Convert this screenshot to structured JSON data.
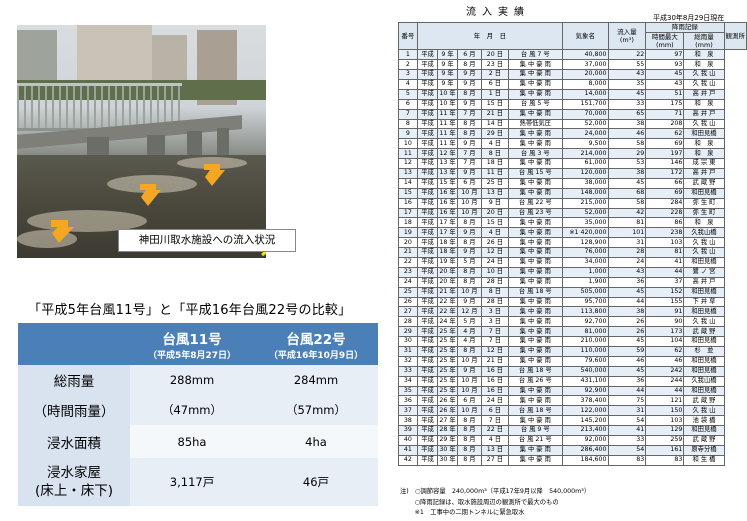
{
  "photo": {
    "caption": "神田川取水施設への流入状況"
  },
  "comparison": {
    "title": "「平成5年台風11号」と「平成16年台風22号の比較」",
    "col1_name": "台風11号",
    "col1_date": "（平成5年8月27日）",
    "col2_name": "台風22号",
    "col2_date": "（平成16年10月9日）",
    "rows": [
      {
        "label": "総雨量",
        "v1": "288mm",
        "v2": "284mm"
      },
      {
        "label": "（時間雨量）",
        "v1": "（47mm）",
        "v2": "（57mm）"
      },
      {
        "label": "浸水面積",
        "v1": "85ha",
        "v2": "4ha"
      },
      {
        "label": "浸水家屋",
        "label2": "(床上・床下)",
        "v1": "3,117戸",
        "v2": "46戸"
      }
    ]
  },
  "inflow": {
    "title": "流入実績",
    "date": "平成30年8月29日現在",
    "headers": {
      "no": "番号",
      "ymd": "年　月　日",
      "type": "気象名",
      "volume": "流入量",
      "volume_unit": "(m³)",
      "rain_group": "降雨記録",
      "max_rain": "時間最大",
      "max_unit": "(mm)",
      "total_rain": "総雨量",
      "total_unit": "(mm)",
      "station": "観測所"
    },
    "rows": [
      [
        "1",
        "平成",
        "9",
        "6",
        "20",
        "台 風 7 号",
        "40,800",
        "22",
        "97",
        "和　泉"
      ],
      [
        "2",
        "平成",
        "9",
        "8",
        "23",
        "集 中 豪 雨",
        "37,000",
        "55",
        "93",
        "和　泉"
      ],
      [
        "3",
        "平成",
        "9",
        "9",
        "2",
        "集 中 豪 雨",
        "20,000",
        "43",
        "45",
        "久 我 山"
      ],
      [
        "4",
        "平成",
        "9",
        "9",
        "6",
        "集 中 豪 雨",
        "8,000",
        "35",
        "43",
        "久 我 山"
      ],
      [
        "5",
        "平成",
        "10",
        "8",
        "1",
        "集 中 豪 雨",
        "14,000",
        "45",
        "51",
        "高 井 戸"
      ],
      [
        "6",
        "平成",
        "10",
        "9",
        "15",
        "台 風 5 号",
        "151,700",
        "33",
        "175",
        "和　泉"
      ],
      [
        "7",
        "平成",
        "11",
        "7",
        "21",
        "集 中 豪 雨",
        "70,000",
        "65",
        "71",
        "高 井 戸"
      ],
      [
        "8",
        "平成",
        "11",
        "8",
        "14",
        "熱帯低気圧",
        "52,000",
        "38",
        "208",
        "久 我 山"
      ],
      [
        "9",
        "平成",
        "11",
        "8",
        "29",
        "集 中 豪 雨",
        "24,000",
        "46",
        "62",
        "和田見橋"
      ],
      [
        "10",
        "平成",
        "11",
        "9",
        "4",
        "集 中 豪 雨",
        "9,500",
        "58",
        "69",
        "和　泉"
      ],
      [
        "11",
        "平成",
        "12",
        "7",
        "8",
        "台 風 3 号",
        "214,000",
        "29",
        "197",
        "和　泉"
      ],
      [
        "12",
        "平成",
        "13",
        "7",
        "18",
        "集 中 豪 雨",
        "61,000",
        "53",
        "146",
        "成 宗 東"
      ],
      [
        "13",
        "平成",
        "13",
        "9",
        "11",
        "台 風 15 号",
        "120,000",
        "38",
        "172",
        "高 井 戸"
      ],
      [
        "14",
        "平成",
        "15",
        "6",
        "25",
        "集 中 豪 雨",
        "38,000",
        "45",
        "66",
        "武 蔵 野"
      ],
      [
        "15",
        "平成",
        "16",
        "10",
        "13",
        "集 中 豪 雨",
        "148,000",
        "68",
        "69",
        "和田見橋"
      ],
      [
        "16",
        "平成",
        "16",
        "10",
        "9",
        "台 風 22 号",
        "215,000",
        "58",
        "284",
        "弥 生 町"
      ],
      [
        "17",
        "平成",
        "16",
        "10",
        "20",
        "台 風 23 号",
        "52,000",
        "42",
        "228",
        "弥 生 町"
      ],
      [
        "18",
        "平成",
        "17",
        "8",
        "15",
        "集 中 豪 雨",
        "35,000",
        "81",
        "86",
        "和　泉"
      ],
      [
        "19",
        "平成",
        "17",
        "9",
        "4",
        "集 中 豪 雨",
        "※1 420,000",
        "101",
        "238",
        "久我山橋"
      ],
      [
        "20",
        "平成",
        "18",
        "8",
        "26",
        "集 中 豪 雨",
        "128,900",
        "31",
        "103",
        "久 我 山"
      ],
      [
        "21",
        "平成",
        "18",
        "9",
        "12",
        "集 中 豪 雨",
        "76,000",
        "28",
        "81",
        "久 我 山"
      ],
      [
        "22",
        "平成",
        "19",
        "5",
        "24",
        "集 中 豪 雨",
        "34,000",
        "24",
        "41",
        "和田見橋"
      ],
      [
        "23",
        "平成",
        "20",
        "8",
        "10",
        "集 中 豪 雨",
        "1,000",
        "43",
        "44",
        "鷺 ノ 宮"
      ],
      [
        "24",
        "平成",
        "20",
        "8",
        "28",
        "集 中 豪 雨",
        "1,900",
        "36",
        "37",
        "高 井 戸"
      ],
      [
        "25",
        "平成",
        "21",
        "10",
        "8",
        "台 風 18 号",
        "505,000",
        "45",
        "152",
        "和田見橋"
      ],
      [
        "26",
        "平成",
        "22",
        "9",
        "28",
        "集 中 豪 雨",
        "95,700",
        "44",
        "155",
        "下 井 草"
      ],
      [
        "27",
        "平成",
        "22",
        "12",
        "3",
        "集 中 豪 雨",
        "113,800",
        "38",
        "91",
        "和田見橋"
      ],
      [
        "28",
        "平成",
        "24",
        "5",
        "3",
        "集 中 豪 雨",
        "92,700",
        "26",
        "90",
        "久 我 山"
      ],
      [
        "29",
        "平成",
        "25",
        "4",
        "7",
        "集 中 豪 雨",
        "81,000",
        "26",
        "173",
        "武 蔵 野"
      ],
      [
        "30",
        "平成",
        "25",
        "4",
        "7",
        "集 中 豪 雨",
        "210,000",
        "45",
        "104",
        "和田見橋"
      ],
      [
        "31",
        "平成",
        "25",
        "8",
        "12",
        "集 中 豪 雨",
        "110,000",
        "59",
        "62",
        "杉　並"
      ],
      [
        "32",
        "平成",
        "25",
        "10",
        "21",
        "集 中 豪 雨",
        "79,600",
        "46",
        "46",
        "和田見橋"
      ],
      [
        "33",
        "平成",
        "25",
        "9",
        "16",
        "台 風 18 号",
        "540,000",
        "45",
        "242",
        "和田見橋"
      ],
      [
        "34",
        "平成",
        "25",
        "10",
        "16",
        "台 風 26 号",
        "431,100",
        "36",
        "244",
        "久我山橋"
      ],
      [
        "35",
        "平成",
        "25",
        "10",
        "16",
        "集 中 豪 雨",
        "92,900",
        "44",
        "44",
        "和田見橋"
      ],
      [
        "36",
        "平成",
        "26",
        "6",
        "24",
        "集 中 豪 雨",
        "378,400",
        "75",
        "121",
        "武 蔵 野"
      ],
      [
        "37",
        "平成",
        "26",
        "10",
        "6",
        "台 風 18 号",
        "122,000",
        "31",
        "150",
        "久 我 山"
      ],
      [
        "38",
        "平成",
        "27",
        "8",
        "7",
        "集 中 豪 雨",
        "145,200",
        "54",
        "103",
        "池 袋 橋"
      ],
      [
        "39",
        "平成",
        "28",
        "8",
        "22",
        "台 風 9 号",
        "213,400",
        "41",
        "129",
        "和田見橋"
      ],
      [
        "40",
        "平成",
        "29",
        "8",
        "4",
        "台 風 21 号",
        "92,000",
        "33",
        "259",
        "武 蔵 野"
      ],
      [
        "41",
        "平成",
        "30",
        "8",
        "13",
        "集 中 豪 雨",
        "286,400",
        "54",
        "161",
        "原寺分橋"
      ],
      [
        "42",
        "平成",
        "30",
        "8",
        "27",
        "集 中 豪 雨",
        "184,600",
        "83",
        "83",
        "和 生 橋"
      ]
    ],
    "notes": [
      "注)　○調節容量　240,000m³（平成17年9月以降　540,000m³）",
      "　　 ○降雨記録は、取水施設周辺の観測所で最大のもの",
      "　　 ※1　工事中の二期トンネルに緊急取水"
    ]
  }
}
